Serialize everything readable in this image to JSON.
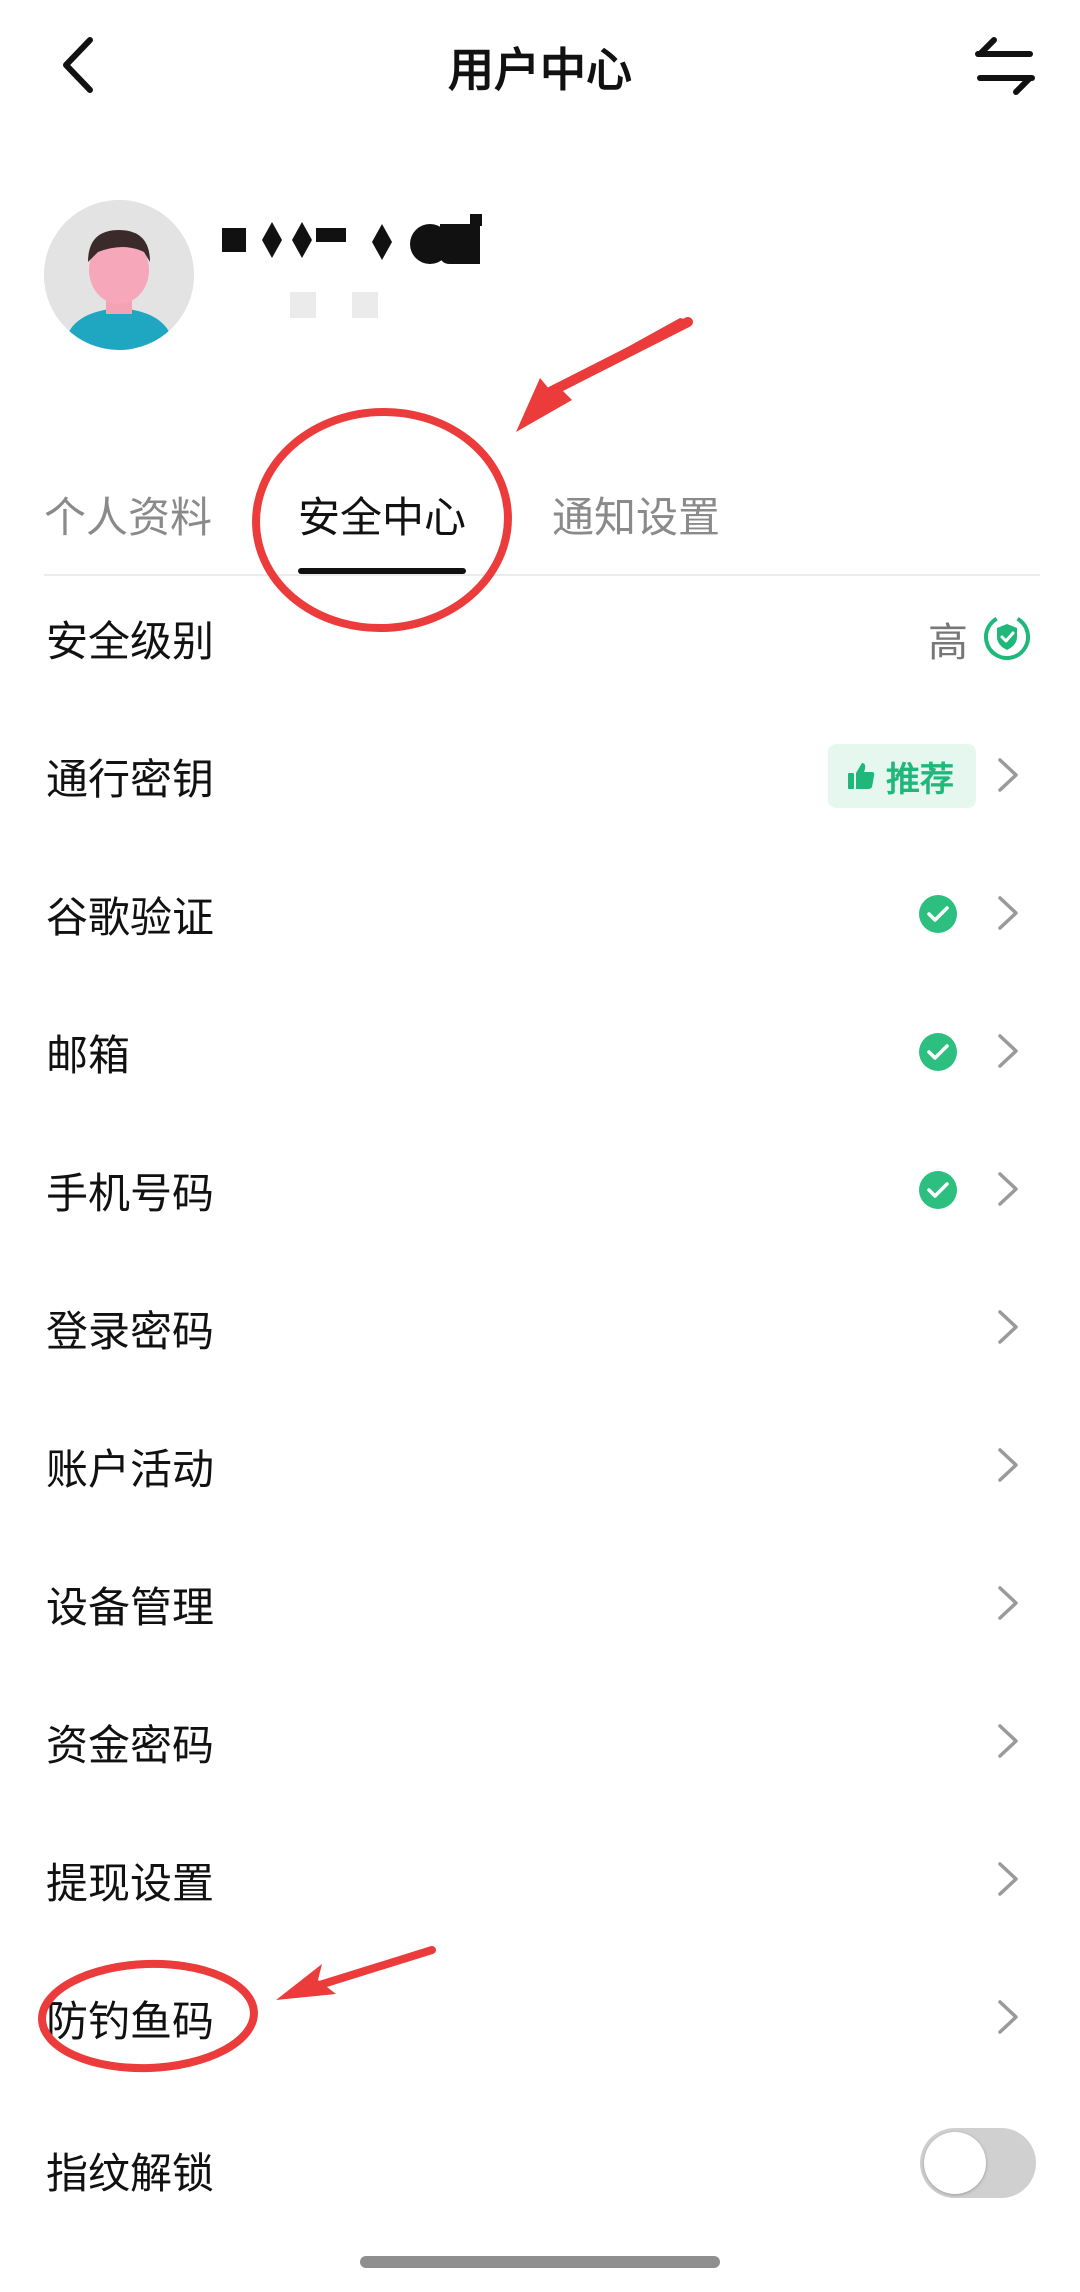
{
  "header": {
    "title": "用户中心"
  },
  "profile": {
    "avatar_icon": "user-avatar-icon"
  },
  "tabs": [
    {
      "label": "个人资料",
      "active": false
    },
    {
      "label": "安全中心",
      "active": true
    },
    {
      "label": "通知设置",
      "active": false
    }
  ],
  "security": {
    "level_label": "安全级别",
    "level_value": "高",
    "passkey_label": "通行密钥",
    "passkey_badge": "推荐",
    "google_auth_label": "谷歌验证",
    "email_label": "邮箱",
    "phone_label": "手机号码",
    "login_password_label": "登录密码",
    "account_activity_label": "账户活动",
    "device_management_label": "设备管理",
    "fund_password_label": "资金密码",
    "withdraw_settings_label": "提现设置",
    "anti_phishing_label": "防钓鱼码",
    "fingerprint_label": "指纹解锁",
    "fingerprint_enabled": false
  },
  "colors": {
    "accent_green": "#1fb87a",
    "check_green": "#2cbf7f",
    "annotation_red": "#ec3b3b",
    "chevron": "#9a9a9a"
  }
}
